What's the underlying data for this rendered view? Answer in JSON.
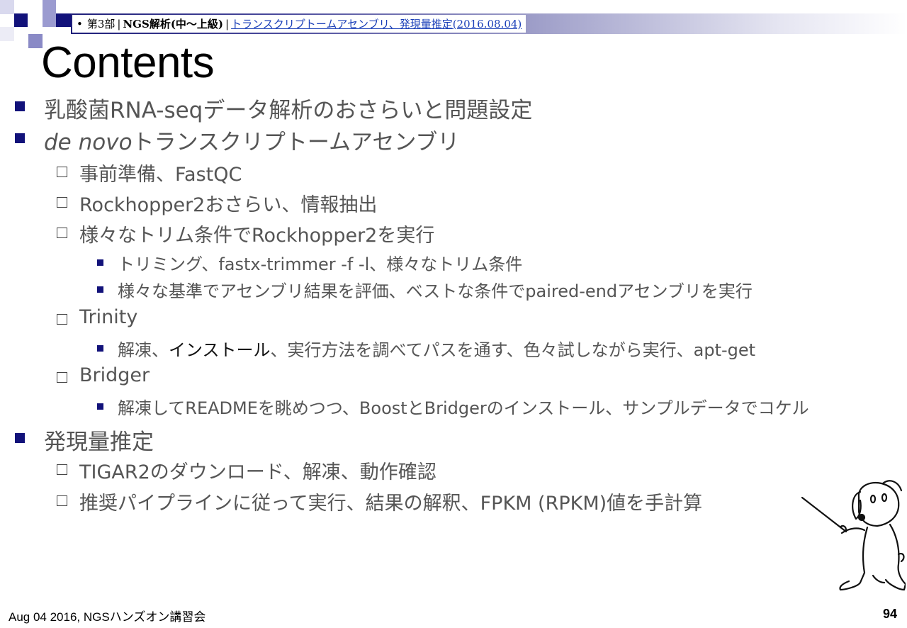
{
  "header": {
    "bullet": "•",
    "part": "第3部",
    "separator1": "|",
    "course": "NGS解析(中～上級)",
    "separator2": "|",
    "link_text": "トランスクリプトームアセンブリ、発現量推定(2016.08.04)"
  },
  "title": "Contents",
  "outline": {
    "item1": "乳酸菌RNA-seqデータ解析のおさらいと問題設定",
    "item2_italic": "de novo",
    "item2_rest": "トランスクリプトームアセンブリ",
    "item2_sub1": "事前準備、FastQC",
    "item2_sub2": "Rockhopper2おさらい、情報抽出",
    "item2_sub3": "様々なトリム条件でRockhopper2を実行",
    "item2_sub3_a": "トリミング、fastx-trimmer -f -l、様々なトリム条件",
    "item2_sub3_b": "様々な基準でアセンブリ結果を評価、ベストな条件でpaired-endアセンブリを実行",
    "item2_sub4": "Trinity",
    "item2_sub4_a_pre": "解凍、",
    "item2_sub4_a_dark": "インストール",
    "item2_sub4_a_post": "、実行方法を調べてパスを通す、色々試しながら実行、apt-get",
    "item2_sub5": "Bridger",
    "item2_sub5_a": "解凍してREADMEを眺めつつ、BoostとBridgerのインストール、サンプルデータでコケル",
    "item3": "発現量推定",
    "item3_sub1": "TIGAR2のダウンロード、解凍、動作確認",
    "item3_sub2": "推奨パイプラインに従って実行、結果の解釈、FPKM (RPKM)値を手計算"
  },
  "footer": {
    "left": "Aug 04 2016, NGSハンズオン講習会",
    "page": "94"
  },
  "colors": {
    "accent": "#12127a",
    "body_text": "#555555",
    "link": "#1a3fb8"
  },
  "icons": {
    "mascot": "dog-pointer-illustration"
  }
}
